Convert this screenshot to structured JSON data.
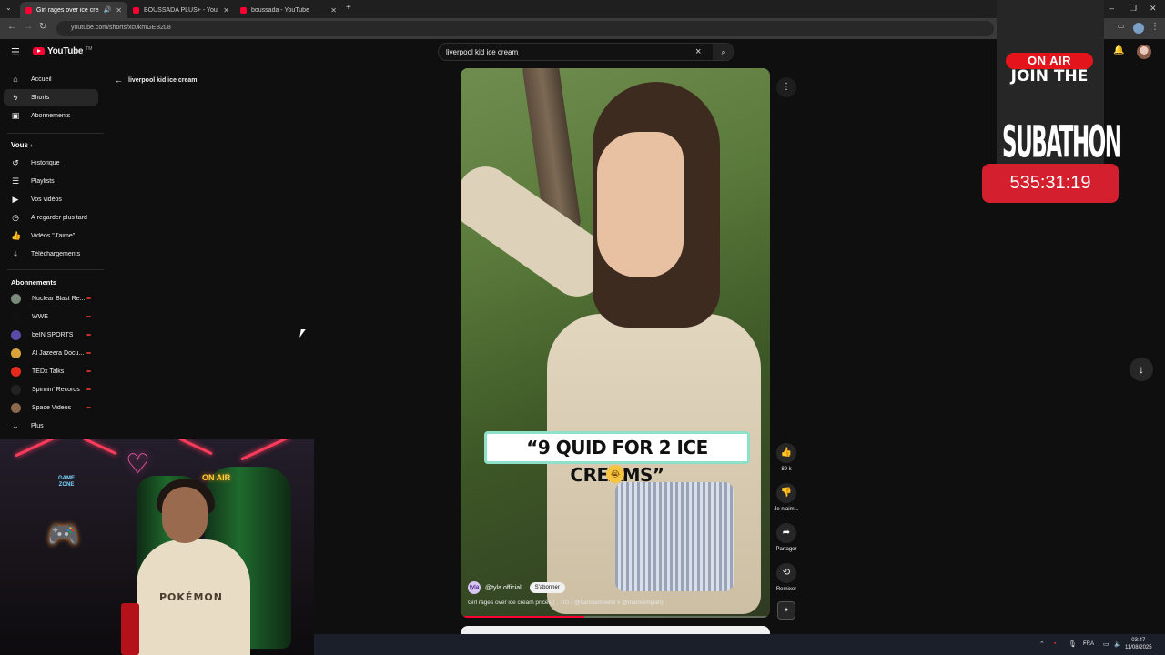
{
  "browser": {
    "tabs": [
      {
        "title": "Girl rages over ice cream p",
        "active": true
      },
      {
        "title": "BOUSSADA PLUS+ - YouTube",
        "active": false
      },
      {
        "title": "boussada - YouTube",
        "active": false
      }
    ],
    "new_tab": "+",
    "url": "youtube.com/shorts/xc0kmGEB2L8"
  },
  "youtube": {
    "logo": "YouTube",
    "logo_tm": "TM",
    "search": {
      "query": "liverpool kid ice cream",
      "clear_icon": "×",
      "search_icon": "⌕"
    },
    "back_label": "liverpool kid ice cream"
  },
  "sidebar": {
    "main": [
      {
        "icon": "home-icon",
        "glyph": "⌂",
        "label": "Accueil"
      },
      {
        "icon": "shorts-icon",
        "glyph": "ϟ",
        "label": "Shorts",
        "active": true
      },
      {
        "icon": "subscriptions-icon",
        "glyph": "▣",
        "label": "Abonnements"
      }
    ],
    "you_title": "Vous",
    "you": [
      {
        "icon": "history-icon",
        "glyph": "↺",
        "label": "Historique"
      },
      {
        "icon": "playlists-icon",
        "glyph": "☰",
        "label": "Playlists"
      },
      {
        "icon": "your-videos-icon",
        "glyph": "▶",
        "label": "Vos vidéos"
      },
      {
        "icon": "watch-later-icon",
        "glyph": "◷",
        "label": "À regarder plus tard"
      },
      {
        "icon": "liked-icon",
        "glyph": "👍",
        "label": "Vidéos \"J'aime\""
      },
      {
        "icon": "downloads-icon",
        "glyph": "⤓",
        "label": "Téléchargements"
      }
    ],
    "subs_title": "Abonnements",
    "subs": [
      {
        "label": "Nuclear Blast Re...",
        "color": "#7a8a7a"
      },
      {
        "label": "WWE",
        "color": "#111111"
      },
      {
        "label": "beIN SPORTS",
        "color": "#5b4aa8"
      },
      {
        "label": "Al Jazeera Docu...",
        "color": "#d8a33a"
      },
      {
        "label": "TEDx Talks",
        "color": "#e62b1e"
      },
      {
        "label": "Spinnin' Records",
        "color": "#222222"
      },
      {
        "label": "Space Videos",
        "color": "#8a6a4a"
      }
    ],
    "more_label": "Plus"
  },
  "short": {
    "caption": "“9 QUID FOR 2 ICE CREAMS”",
    "emoji": "😭",
    "channel": "@tyla.official",
    "channel_avatar": "tyla",
    "subscribe_label": "S'abonner",
    "description": "Girl rages over ice cream prices ( . : IG / @karislambertx x @mamiemylah)",
    "progress": 0.4,
    "actions": [
      {
        "icon": "like-icon",
        "glyph": "👍",
        "label": "89 k"
      },
      {
        "icon": "dislike-icon",
        "glyph": "👎",
        "label": "Je n'aim..."
      },
      {
        "icon": "share-icon",
        "glyph": "➦",
        "label": "Partager"
      },
      {
        "icon": "remix-icon",
        "glyph": "⟲",
        "label": "Remixer"
      }
    ]
  },
  "overlay": {
    "on_air": "ON AIR",
    "join": "JOIN THE",
    "subathon": "SUBATHON",
    "timer": "535:31:19"
  },
  "webcam": {
    "shirt_text": "POKÉMON",
    "sign": "ON AIR",
    "room_sign": "GAME ZONE"
  },
  "taskbar": {
    "lang": "FRA",
    "time": "03:47",
    "date": "11/08/2025"
  },
  "colors": {
    "accent": "#ff0033",
    "timer_bg": "#d4202e",
    "on_air_bg": "#e3141c"
  }
}
